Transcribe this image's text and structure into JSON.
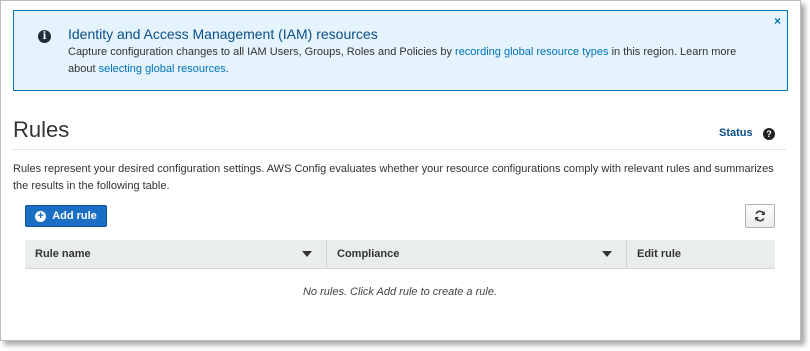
{
  "banner": {
    "icon": "info-icon",
    "title": "Identity and Access Management (IAM) resources",
    "text_before_link1": "Capture configuration changes to all IAM Users, Groups, Roles and Policies by ",
    "link1": "recording global resource types",
    "text_between_links": " in this region. Learn more about ",
    "link2": "selecting global resources",
    "text_after_link2": ".",
    "close_label": "×"
  },
  "page": {
    "title": "Rules",
    "status_link": "Status",
    "help_label": "?",
    "description": "Rules represent your desired configuration settings. AWS Config evaluates whether your resource configurations comply with relevant rules and summarizes the results in the following table."
  },
  "toolbar": {
    "add_rule_label": "Add rule",
    "add_icon": "plus-circle-icon",
    "refresh_icon": "refresh-icon"
  },
  "table": {
    "columns": [
      {
        "label": "Rule name",
        "sortable": true
      },
      {
        "label": "Compliance",
        "sortable": true
      },
      {
        "label": "Edit rule",
        "sortable": false
      }
    ],
    "empty_message": "No rules. Click Add rule to create a rule."
  },
  "colors": {
    "accent": "#0073bb",
    "banner_bg": "#e5f3fc",
    "primary_button": "#1a6fc4",
    "header_bg": "#eaeded"
  }
}
